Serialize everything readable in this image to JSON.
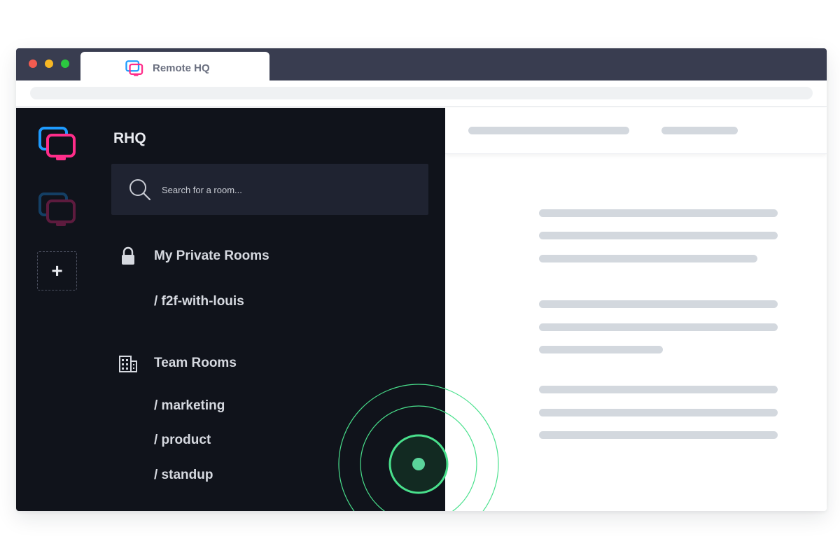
{
  "browser": {
    "tab": {
      "title": "Remote HQ"
    }
  },
  "rail": {
    "items": [
      {
        "icon": "remote-hq-logo-icon",
        "state": "active"
      },
      {
        "icon": "remote-hq-logo-icon",
        "state": "inactive"
      }
    ],
    "add_label": "+"
  },
  "sidebar": {
    "org_name": "RHQ",
    "search": {
      "placeholder": "Search for a room..."
    },
    "sections": [
      {
        "icon": "lock-icon",
        "label": "My Private Rooms",
        "rooms": [
          "/ f2f-with-louis"
        ]
      },
      {
        "icon": "building-icon",
        "label": "Team Rooms",
        "rooms": [
          "/ marketing",
          "/ product",
          "/ standup"
        ]
      }
    ]
  },
  "colors": {
    "accent_pink": "#ff2d8a",
    "accent_blue": "#1e9bff",
    "pulse_green": "#49e08c",
    "sidebar_bg": "#10131b"
  }
}
